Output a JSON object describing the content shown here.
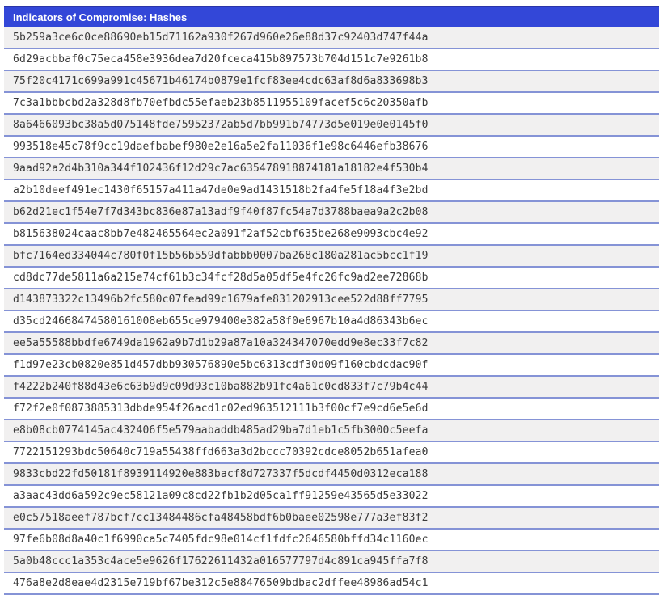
{
  "header": {
    "title": "Indicators of Compromise: Hashes"
  },
  "table": {
    "rows": [
      "5b259a3ce6c0ce88690eb15d71162a930f267d960e26e88d37c92403d747f44a",
      "6d29acbbaf0c75eca458e3936dea7d20fceca415b897573b704d151c7e9261b8",
      "75f20c4171c699a991c45671b46174b0879e1fcf83ee4cdc63af8d6a833698b3",
      "7c3a1bbbcbd2a328d8fb70efbdc55efaeb23b8511955109facef5c6c20350afb",
      "8a6466093bc38a5d075148fde75952372ab5d7bb991b74773d5e019e0e0145f0",
      "993518e45c78f9cc19daefbabef980e2e16a5e2fa11036f1e98c6446efb38676",
      "9aad92a2d4b310a344f102436f12d29c7ac635478918874181a18182e4f530b4",
      "a2b10deef491ec1430f65157a411a47de0e9ad1431518b2fa4fe5f18a4f3e2bd",
      "b62d21ec1f54e7f7d343bc836e87a13adf9f40f87fc54a7d3788baea9a2c2b08",
      "b815638024caac8bb7e482465564ec2a091f2af52cbf635be268e9093cbc4e92",
      "bfc7164ed334044c780f0f15b56b559dfabbb0007ba268c180a281ac5bcc1f19",
      "cd8dc77de5811a6a215e74cf61b3c34fcf28d5a05df5e4fc26fc9ad2ee72868b",
      "d143873322c13496b2fc580c07fead99c1679afe831202913cee522d88ff7795",
      "d35cd24668474580161008eb655ce979400e382a58f0e6967b10a4d86343b6ec",
      "ee5a55588bbdfe6749da1962a9b7d1b29a87a10a324347070edd9e8ec33f7c82",
      "f1d97e23cb0820e851d457dbb930576890e5bc6313cdf30d09f160cbdcdac90f",
      "f4222b240f88d43e6c63b9d9c09d93c10ba882b91fc4a61c0cd833f7c79b4c44",
      "f72f2e0f0873885313dbde954f26acd1c02ed963512111b3f00cf7e9cd6e5e6d",
      "e8b08cb0774145ac432406f5e579aabaddb485ad29ba7d1eb1c5fb3000c5eefa",
      "7722151293bdc50640c719a55438ffd663a3d2bccc70392cdce8052b651afea0",
      "9833cbd22fd50181f8939114920e883bacf8d727337f5dcdf4450d0312eca188",
      "a3aac43dd6a592c9ec58121a09c8cd22fb1b2d05ca1ff91259e43565d5e33022",
      "e0c57518aeef787bcf7cc13484486cfa48458bdf6b0baee02598e777a3ef83f2",
      "97fe6b08d8a40c1f6990ca5c7405fdc98e014cf1fdfc2646580bffd34c1160ec",
      "5a0b48ccc1a353c4ace5e9626f17622611432a016577797d4c891ca945ffa7f8",
      "476a8e2d8eae4d2315e719bf67be312c5e88476509bdbac2dffee48986ad54c1"
    ]
  },
  "colors": {
    "header_bg": "#3347d8",
    "header_border": "#2b35a8",
    "row_alt_bg": "#f1f0f0",
    "row_bg": "#ffffff",
    "separator": "#8593d6",
    "text": "#3a3a3a"
  }
}
